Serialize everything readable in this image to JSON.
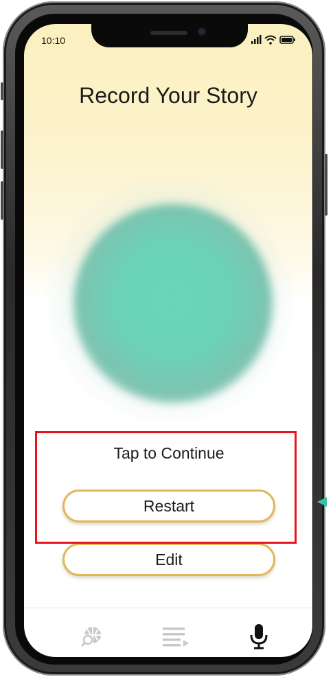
{
  "status_bar": {
    "time": "10:10"
  },
  "page": {
    "title": "Record Your Story"
  },
  "prompt": {
    "tap_text": "Tap to Continue"
  },
  "buttons": {
    "restart_label": "Restart",
    "edit_label": "Edit"
  },
  "tab_bar": {
    "items": [
      {
        "icon": "globe-search-icon",
        "active": false
      },
      {
        "icon": "playlist-icon",
        "active": false
      },
      {
        "icon": "microphone-icon",
        "active": true
      }
    ]
  },
  "colors": {
    "accent_border": "#e2b65a",
    "orb": "#69d6b9",
    "highlight": "#e8141c",
    "header_gradient": "#fbf0bf",
    "inactive_icon": "#c8c8c8",
    "active_icon": "#111111"
  }
}
